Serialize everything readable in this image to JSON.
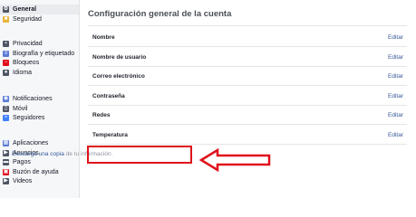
{
  "sidebar": {
    "groups": [
      [
        {
          "label": "General",
          "icon": "gear-icon",
          "active": true
        },
        {
          "label": "Seguridad",
          "icon": "shield-icon"
        }
      ],
      [
        {
          "label": "Privacidad",
          "icon": "lock-icon"
        },
        {
          "label": "Biografía y etiquetado",
          "icon": "timeline-icon"
        },
        {
          "label": "Bloqueos",
          "icon": "block-icon"
        },
        {
          "label": "Idioma",
          "icon": "language-icon"
        }
      ],
      [
        {
          "label": "Notificaciones",
          "icon": "globe-icon"
        },
        {
          "label": "Móvil",
          "icon": "mobile-icon"
        },
        {
          "label": "Seguidores",
          "icon": "rss-icon"
        }
      ],
      [
        {
          "label": "Aplicaciones",
          "icon": "apps-icon"
        },
        {
          "label": "Anuncios",
          "icon": "ads-icon"
        },
        {
          "label": "Pagos",
          "icon": "payments-icon"
        },
        {
          "label": "Buzón de ayuda",
          "icon": "help-inbox-icon"
        },
        {
          "label": "Videos",
          "icon": "video-icon"
        }
      ]
    ]
  },
  "main": {
    "title": "Configuración general de la cuenta",
    "edit_label": "Editar",
    "rows": [
      "Nombre",
      "Nombre de usuario",
      "Correo electrónico",
      "Contraseña",
      "Redes",
      "Temperatura"
    ],
    "download": {
      "link": "Descarga una copia",
      "rest": " de tu información."
    }
  },
  "colors": {
    "link": "#365899",
    "highlight": "#e0101a",
    "sidebar_bg": "#f6f7f9"
  }
}
